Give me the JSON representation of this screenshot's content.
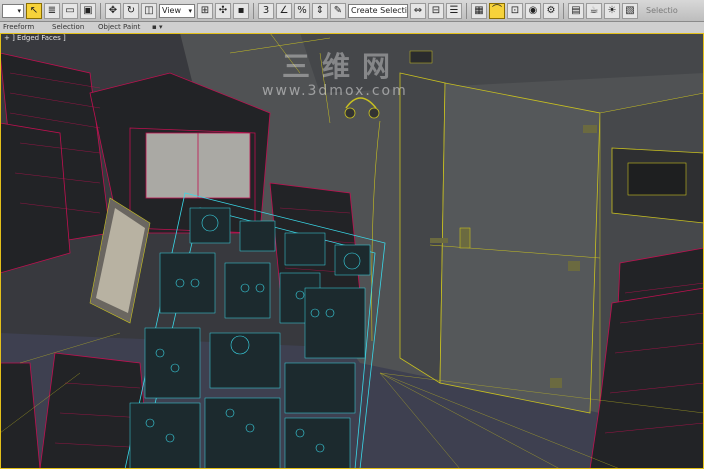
{
  "toolbar": {
    "view_dropdown": "View",
    "selection_set_dropdown": "Create Selection Se",
    "disabled_label": "Selectio"
  },
  "ribbon": {
    "freeform": "Freeform",
    "selection": "Selection",
    "object_paint": "Object Paint"
  },
  "viewport": {
    "label": "+ ] Edged Faces ]"
  },
  "watermark": {
    "text": "三维网",
    "url": "www.3dmox.com"
  },
  "colors": {
    "accent": "#f6d23a",
    "viewport_border": "#e3c01a",
    "wire_red": "#c01050",
    "wire_cyan": "#3ad8e8",
    "wire_yellow": "#c8c020"
  }
}
